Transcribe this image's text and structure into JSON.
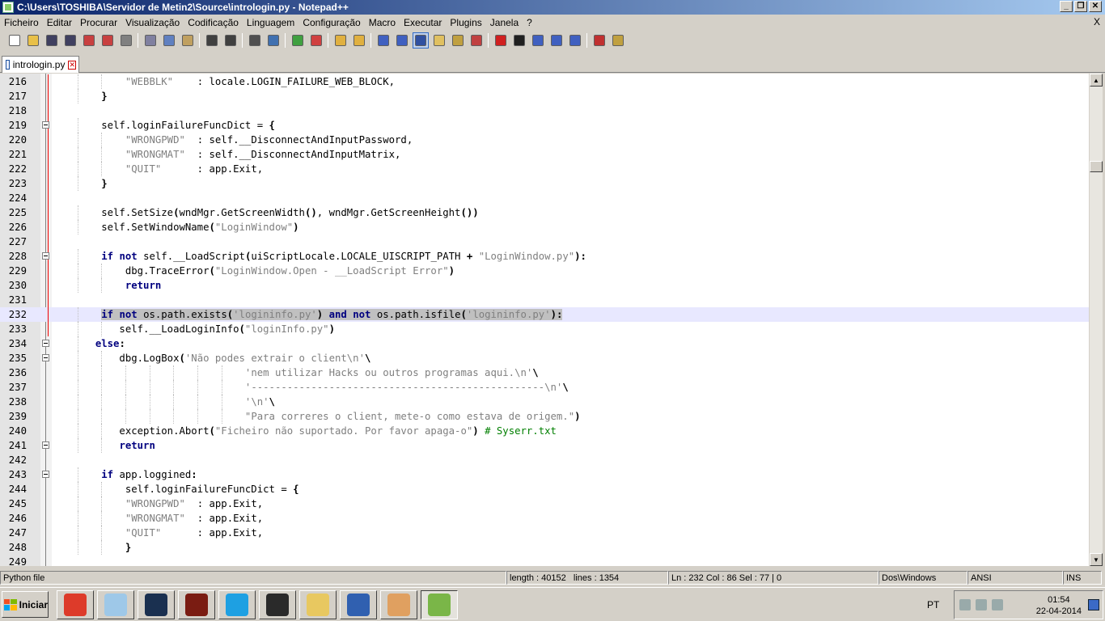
{
  "window": {
    "title": "C:\\Users\\TOSHIBA\\Servidor de Metin2\\Source\\intrologin.py - Notepad++",
    "minimize_glyph": "_",
    "restore_glyph": "❐",
    "close_glyph": "✕"
  },
  "menu": {
    "items": [
      "Ficheiro",
      "Editar",
      "Procurar",
      "Visualização",
      "Codificação",
      "Linguagem",
      "Configuração",
      "Macro",
      "Executar",
      "Plugins",
      "Janela",
      "?"
    ],
    "close_glyph": "X"
  },
  "toolbar": {
    "buttons": [
      {
        "name": "new-file-icon",
        "color": "#ffffff"
      },
      {
        "name": "open-file-icon",
        "color": "#e8c048"
      },
      {
        "name": "save-icon",
        "color": "#404060"
      },
      {
        "name": "save-all-icon",
        "color": "#404060"
      },
      {
        "name": "close-file-icon",
        "color": "#c84040"
      },
      {
        "name": "close-all-icon",
        "color": "#c84040"
      },
      {
        "name": "print-icon",
        "color": "#808080"
      },
      {
        "sep": true
      },
      {
        "name": "cut-icon",
        "color": "#8080a0"
      },
      {
        "name": "copy-icon",
        "color": "#6080c0"
      },
      {
        "name": "paste-icon",
        "color": "#c0a060"
      },
      {
        "sep": true
      },
      {
        "name": "undo-icon",
        "color": "#404040"
      },
      {
        "name": "redo-icon",
        "color": "#404040"
      },
      {
        "sep": true
      },
      {
        "name": "find-icon",
        "color": "#505050"
      },
      {
        "name": "replace-icon",
        "color": "#4070b0"
      },
      {
        "sep": true
      },
      {
        "name": "zoom-in-icon",
        "color": "#40a040"
      },
      {
        "name": "zoom-out-icon",
        "color": "#d04040"
      },
      {
        "sep": true
      },
      {
        "name": "sync-vertical-icon",
        "color": "#e0b040"
      },
      {
        "name": "sync-horizontal-icon",
        "color": "#e0b040"
      },
      {
        "sep": true
      },
      {
        "name": "word-wrap-icon",
        "color": "#4060c0"
      },
      {
        "name": "show-all-chars-icon",
        "color": "#4060c0"
      },
      {
        "name": "indent-guide-icon",
        "color": "#3050a0",
        "active": true
      },
      {
        "name": "user-defined-lang-icon",
        "color": "#e0c060"
      },
      {
        "name": "doc-map-icon",
        "color": "#c0a040"
      },
      {
        "name": "function-list-icon",
        "color": "#c04040"
      },
      {
        "sep": true
      },
      {
        "name": "record-macro-icon",
        "color": "#d02020"
      },
      {
        "name": "stop-macro-icon",
        "color": "#202020"
      },
      {
        "name": "play-macro-icon",
        "color": "#4060c0"
      },
      {
        "name": "run-macro-multiple-icon",
        "color": "#4060c0"
      },
      {
        "name": "save-macro-icon",
        "color": "#4060c0"
      },
      {
        "sep": true
      },
      {
        "name": "spell-check-icon",
        "color": "#c03030"
      },
      {
        "name": "plugin-icon",
        "color": "#c0a040"
      }
    ]
  },
  "tab": {
    "label": "intrologin.py"
  },
  "editor": {
    "lines": [
      {
        "n": "216",
        "fold": "line",
        "red": true,
        "tokens": [
          [
            "",
            "            "
          ],
          [
            "st",
            "\"WEBBLK\""
          ],
          [
            "",
            "    : locale.LOGIN_FAILURE_WEB_BLOCK,"
          ]
        ]
      },
      {
        "n": "217",
        "fold": "line",
        "red": true,
        "tokens": [
          [
            "",
            "        "
          ],
          [
            "op",
            "}"
          ]
        ]
      },
      {
        "n": "218",
        "fold": "line",
        "red": true,
        "tokens": []
      },
      {
        "n": "219",
        "fold": "box",
        "red": true,
        "tokens": [
          [
            "",
            "        self.loginFailureFuncDict = "
          ],
          [
            "op",
            "{"
          ]
        ]
      },
      {
        "n": "220",
        "fold": "line",
        "red": true,
        "tokens": [
          [
            "",
            "            "
          ],
          [
            "st",
            "\"WRONGPWD\""
          ],
          [
            "",
            "  : self.__DisconnectAndInputPassword,"
          ]
        ]
      },
      {
        "n": "221",
        "fold": "line",
        "red": true,
        "tokens": [
          [
            "",
            "            "
          ],
          [
            "st",
            "\"WRONGMAT\""
          ],
          [
            "",
            "  : self.__DisconnectAndInputMatrix,"
          ]
        ]
      },
      {
        "n": "222",
        "fold": "line",
        "red": true,
        "tokens": [
          [
            "",
            "            "
          ],
          [
            "st",
            "\"QUIT\""
          ],
          [
            "",
            "      : app.Exit,"
          ]
        ]
      },
      {
        "n": "223",
        "fold": "line",
        "red": true,
        "tokens": [
          [
            "",
            "        "
          ],
          [
            "op",
            "}"
          ]
        ]
      },
      {
        "n": "224",
        "fold": "line",
        "red": true,
        "tokens": []
      },
      {
        "n": "225",
        "fold": "line",
        "red": true,
        "tokens": [
          [
            "",
            "        self.SetSize"
          ],
          [
            "op",
            "("
          ],
          [
            "",
            "wndMgr.GetScreenWidth"
          ],
          [
            "op",
            "()"
          ],
          [
            "",
            ", wndMgr.GetScreenHeight"
          ],
          [
            "op",
            "())"
          ]
        ]
      },
      {
        "n": "226",
        "fold": "line",
        "red": true,
        "tokens": [
          [
            "",
            "        self.SetWindowName"
          ],
          [
            "op",
            "("
          ],
          [
            "st",
            "\"LoginWindow\""
          ],
          [
            "op",
            ")"
          ]
        ]
      },
      {
        "n": "227",
        "fold": "line",
        "red": true,
        "tokens": []
      },
      {
        "n": "228",
        "fold": "box",
        "red": true,
        "tokens": [
          [
            "",
            "        "
          ],
          [
            "kw",
            "if"
          ],
          [
            "",
            " "
          ],
          [
            "kw",
            "not"
          ],
          [
            "",
            " self.__LoadScript"
          ],
          [
            "op",
            "("
          ],
          [
            "",
            "uiScriptLocale.LOCALE_UISCRIPT_PATH "
          ],
          [
            "op",
            "+"
          ],
          [
            "",
            " "
          ],
          [
            "st",
            "\"LoginWindow.py\""
          ],
          [
            "op",
            "):"
          ]
        ]
      },
      {
        "n": "229",
        "fold": "line",
        "red": true,
        "tokens": [
          [
            "",
            "            dbg.TraceError"
          ],
          [
            "op",
            "("
          ],
          [
            "st",
            "\"LoginWindow.Open - __LoadScript Error\""
          ],
          [
            "op",
            ")"
          ]
        ]
      },
      {
        "n": "230",
        "fold": "line",
        "red": true,
        "tokens": [
          [
            "",
            "            "
          ],
          [
            "kw",
            "return"
          ]
        ]
      },
      {
        "n": "231",
        "fold": "line",
        "red": true,
        "tokens": []
      },
      {
        "n": "232",
        "fold": "line",
        "red": true,
        "current": true,
        "tokens": [
          [
            "",
            "        "
          ],
          [
            "sel kw",
            "if"
          ],
          [
            "sel",
            " "
          ],
          [
            "sel kw",
            "not"
          ],
          [
            "sel",
            " os.path.exists"
          ],
          [
            "sel op",
            "("
          ],
          [
            "sel st",
            "'logininfo.py'"
          ],
          [
            "sel op",
            ")"
          ],
          [
            "sel",
            " "
          ],
          [
            "sel kw",
            "and"
          ],
          [
            "sel",
            " "
          ],
          [
            "sel kw",
            "not"
          ],
          [
            "sel",
            " os.path.isfile"
          ],
          [
            "sel op",
            "("
          ],
          [
            "sel st",
            "'logininfo.py'"
          ],
          [
            "sel op",
            "):"
          ]
        ]
      },
      {
        "n": "233",
        "fold": "line",
        "red": true,
        "tokens": [
          [
            "",
            "           self.__LoadLoginInfo"
          ],
          [
            "op",
            "("
          ],
          [
            "st",
            "\"loginInfo.py\""
          ],
          [
            "op",
            ")"
          ]
        ]
      },
      {
        "n": "234",
        "fold": "box",
        "red": false,
        "tokens": [
          [
            "",
            "       "
          ],
          [
            "kw",
            "else"
          ],
          [
            "op",
            ":"
          ]
        ]
      },
      {
        "n": "235",
        "fold": "box",
        "red": false,
        "tokens": [
          [
            "",
            "           dbg.LogBox"
          ],
          [
            "op",
            "("
          ],
          [
            "st",
            "'Não podes extrair o client\\n'"
          ],
          [
            "op",
            "\\"
          ]
        ]
      },
      {
        "n": "236",
        "fold": "line",
        "red": false,
        "tokens": [
          [
            "",
            "                                "
          ],
          [
            "st",
            "'nem utilizar Hacks ou outros programas aqui.\\n'"
          ],
          [
            "op",
            "\\"
          ]
        ]
      },
      {
        "n": "237",
        "fold": "line",
        "red": false,
        "tokens": [
          [
            "",
            "                                "
          ],
          [
            "st",
            "'-------------------------------------------------\\n'"
          ],
          [
            "op",
            "\\"
          ]
        ]
      },
      {
        "n": "238",
        "fold": "line",
        "red": false,
        "tokens": [
          [
            "",
            "                                "
          ],
          [
            "st",
            "'\\n'"
          ],
          [
            "op",
            "\\"
          ]
        ]
      },
      {
        "n": "239",
        "fold": "line",
        "red": false,
        "tokens": [
          [
            "",
            "                                "
          ],
          [
            "st",
            "\"Para correres o client, mete-o como estava de origem.\""
          ],
          [
            "op",
            ")"
          ]
        ]
      },
      {
        "n": "240",
        "fold": "line",
        "red": false,
        "tokens": [
          [
            "",
            "           exception.Abort"
          ],
          [
            "op",
            "("
          ],
          [
            "st",
            "\"Ficheiro não suportado. Por favor apaga-o\""
          ],
          [
            "op",
            ")"
          ],
          [
            "",
            " "
          ],
          [
            "cm",
            "# Syserr.txt"
          ]
        ]
      },
      {
        "n": "241",
        "fold": "box",
        "red": false,
        "tokens": [
          [
            "",
            "           "
          ],
          [
            "kw",
            "return"
          ]
        ]
      },
      {
        "n": "242",
        "fold": "line",
        "red": false,
        "tokens": []
      },
      {
        "n": "243",
        "fold": "box",
        "red": false,
        "tokens": [
          [
            "",
            "        "
          ],
          [
            "kw",
            "if"
          ],
          [
            "",
            " app.loggined"
          ],
          [
            "op",
            ":"
          ]
        ]
      },
      {
        "n": "244",
        "fold": "line",
        "red": false,
        "tokens": [
          [
            "",
            "            self.loginFailureFuncDict = "
          ],
          [
            "op",
            "{"
          ]
        ]
      },
      {
        "n": "245",
        "fold": "line",
        "red": false,
        "tokens": [
          [
            "",
            "            "
          ],
          [
            "st",
            "\"WRONGPWD\""
          ],
          [
            "",
            "  : app.Exit,"
          ]
        ]
      },
      {
        "n": "246",
        "fold": "line",
        "red": false,
        "tokens": [
          [
            "",
            "            "
          ],
          [
            "st",
            "\"WRONGMAT\""
          ],
          [
            "",
            "  : app.Exit,"
          ]
        ]
      },
      {
        "n": "247",
        "fold": "line",
        "red": false,
        "tokens": [
          [
            "",
            "            "
          ],
          [
            "st",
            "\"QUIT\""
          ],
          [
            "",
            "      : app.Exit,"
          ]
        ]
      },
      {
        "n": "248",
        "fold": "line",
        "red": false,
        "tokens": [
          [
            "",
            "            "
          ],
          [
            "op",
            "}"
          ]
        ]
      },
      {
        "n": "249",
        "fold": "line",
        "red": false,
        "tokens": []
      }
    ]
  },
  "statusbar": {
    "file_type": "Python file",
    "length": "length : 40152",
    "lines": "lines : 1354",
    "position": "Ln : 232    Col : 86    Sel : 77 | 0",
    "eol": "Dos\\Windows",
    "encoding": "ANSI",
    "mode": "INS"
  },
  "taskbar": {
    "start_label": "Iniciar",
    "apps": [
      {
        "name": "chrome-icon",
        "color": "#dd3b2a"
      },
      {
        "name": "notepad-icon",
        "color": "#9ec8e8"
      },
      {
        "name": "league-of-legends-icon",
        "color": "#1a3050"
      },
      {
        "name": "metin2-icon",
        "color": "#7a1c12"
      },
      {
        "name": "skype-icon",
        "color": "#1ea0e2"
      },
      {
        "name": "steam-icon",
        "color": "#2a2a2a"
      },
      {
        "name": "file-explorer-icon",
        "color": "#e8c860"
      },
      {
        "name": "vpn-icon",
        "color": "#3060b0"
      },
      {
        "name": "paint-icon",
        "color": "#e0a060"
      },
      {
        "name": "notepad-plus-plus-icon",
        "color": "#7ab648",
        "active": true
      }
    ],
    "language": "PT",
    "time": "01:54",
    "date": "22-04-2014"
  }
}
